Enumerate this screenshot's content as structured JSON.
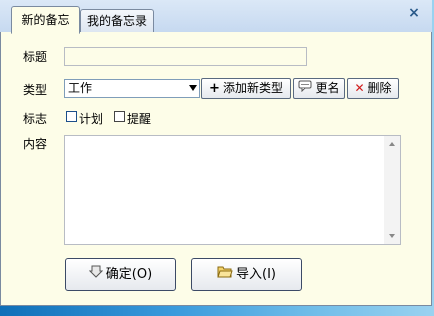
{
  "tabs": [
    {
      "label": "新的备忘",
      "active": true
    },
    {
      "label": "我的备忘录",
      "active": false
    }
  ],
  "close_glyph": "×",
  "form": {
    "title_label": "标题",
    "title_value": "",
    "type_label": "类型",
    "type_selected": "工作",
    "add_type_label": "添加新类型",
    "rename_label": "更名",
    "delete_label": "删除",
    "flag_label": "标志",
    "plan_label": "计划",
    "remind_label": "提醒",
    "content_label": "内容",
    "content_value": ""
  },
  "buttons": {
    "confirm_label": "确定(O)",
    "import_label": "导入(I)"
  },
  "icons": {
    "add": "plus-icon",
    "rename": "speech-bubble-icon",
    "delete": "x-icon",
    "confirm": "down-arrow-icon",
    "import": "folder-icon"
  },
  "colors": {
    "panel_bg": "#fdfde8",
    "tabbar_bg": "#c6d9f0",
    "desktop": "#1a78c2",
    "delete_red": "#d11a1a"
  }
}
